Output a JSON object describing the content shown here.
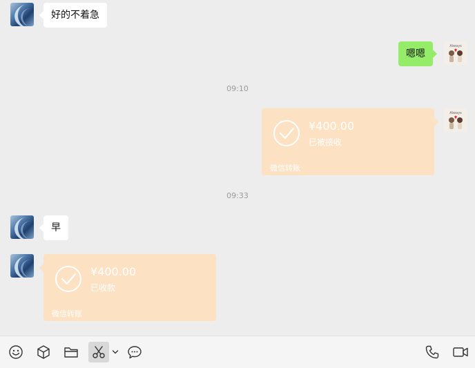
{
  "messages": {
    "m1_text": "好的不着急",
    "m2_text": "嗯嗯",
    "time1": "09:10",
    "t1": {
      "amount": "¥400.00",
      "status": "已被接收",
      "brand": "微信转账"
    },
    "time2": "09:33",
    "m3_text": "早",
    "t2": {
      "amount": "¥400.00",
      "status": "已收款",
      "brand": "微信转账"
    }
  },
  "icons": {
    "emoji": "emoji-icon",
    "favorites": "cube-icon",
    "file": "folder-icon",
    "screenshot": "scissors-icon",
    "screenshot_options": "chevron-down-icon",
    "chat_history": "speech-bubble-icon",
    "voice_call": "phone-icon",
    "video_call": "video-camera-icon"
  },
  "colors": {
    "chat_background": "#ededed",
    "sent_bubble": "#95ec69",
    "received_bubble": "#ffffff",
    "transfer_card": "#fde1c3"
  }
}
